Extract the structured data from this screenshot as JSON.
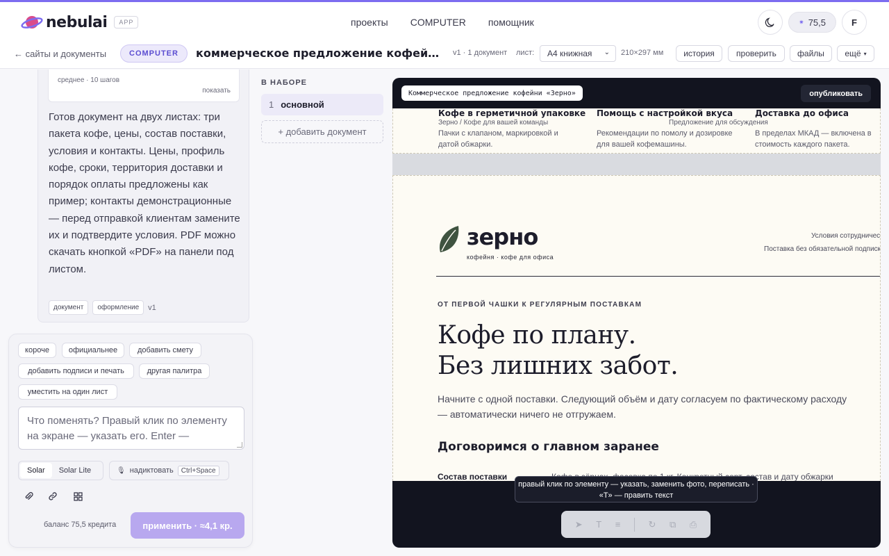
{
  "header": {
    "logo_text": "nebulai",
    "app_badge": "APP",
    "nav": [
      "проекты",
      "COMPUTER",
      "помощник"
    ],
    "credits": "75,5",
    "avatar": "F",
    "theme_icon": "moon-icon"
  },
  "subbar": {
    "back": "← сайты и документы",
    "badge": "COMPUTER",
    "title": "коммерческое предложение кофейни «Зерно»",
    "version": "v1 · 1 документ",
    "sheet_label": "лист:",
    "sheet_value": "А4 книжная",
    "size": "210×297 мм",
    "buttons": {
      "history": "история",
      "check": "проверить",
      "files": "файлы",
      "more": "ещё"
    }
  },
  "chat": {
    "steps": "среднее · 10 шагов",
    "show": "показать",
    "message": "Готов документ на двух листах: три пакета кофе, цены, состав поставки, условия и контакты. Цены, профиль кофе, сроки, территория доставки и порядок оплаты предложены как пример; контакты демонстрационные — перед отправкой клиентам замените их и подтвердите условия. PDF можно скачать кнопкой «PDF» на панели под листом.",
    "tags": [
      "документ",
      "оформление"
    ],
    "version": "v1"
  },
  "composer": {
    "chips": [
      "короче",
      "официальнее",
      "добавить смету",
      "добавить подписи и печать",
      "другая палитра",
      "уместить на один лист"
    ],
    "placeholder": "Что поменять? Правый клик по элементу на экране — указать его. Enter — отправить",
    "models": [
      "Solar",
      "Solar Lite"
    ],
    "dictate": "надиктовать",
    "shortcut": "Ctrl+Space",
    "icons": [
      "paperclip-icon",
      "link-icon",
      "grid-icon"
    ],
    "balance": "баланс 75,5 кредита",
    "apply": "применить · ≈4,1 кр."
  },
  "set": {
    "heading": "В НАБОРЕ",
    "items": [
      {
        "num": "1",
        "name": "основной"
      }
    ],
    "add": "+ добавить документ"
  },
  "preview": {
    "title": "Коммерческое предложение кофейни «Зерно»",
    "publish": "опубликовать",
    "features": [
      {
        "title": "Кофе в герметичной упаковке",
        "desc": "Пачки с клапаном, маркировкой и датой обжарки."
      },
      {
        "title": "Помощь с настройкой вкуса",
        "desc": "Рекомендации по помолу и дозировке для вашей кофемашины."
      },
      {
        "title": "Доставка до офиса",
        "desc": "В пределах МКАД — включена в стоимость каждого пакета."
      }
    ],
    "running_header": "Зерно / Кофе для вашей команды",
    "running_header_right": "Предложение для обсуждения",
    "brand": "зерно",
    "brand_sub": "кофейня · кофе для офиса",
    "terms": [
      "Условия сотрудничества",
      "Поставка без обязательной подписки"
    ],
    "kicker": "ОТ ПЕРВОЙ ЧАШКИ К РЕГУЛЯРНЫМ ПОСТАВКАМ",
    "headline_1": "Кофе по плану.",
    "headline_2": "Без лишних забот.",
    "lead": "Начните с одной поставки. Следующий объём и дату согласуем по фактическому расходу — автоматически ничего не отгружаем.",
    "section": "Договоримся о главном заранее",
    "row_key": "Состав поставки",
    "row_value": "Кофе в зёрнах, фасовка по 1 кг. Конкретный сорт, состав и дату обжарки",
    "hint": "правый клик по элементу — указать, заменить фото, переписать · «T» — править текст",
    "tools": [
      "cursor-icon",
      "text-icon",
      "list-icon",
      "refresh-icon",
      "external-icon",
      "print-icon"
    ]
  }
}
